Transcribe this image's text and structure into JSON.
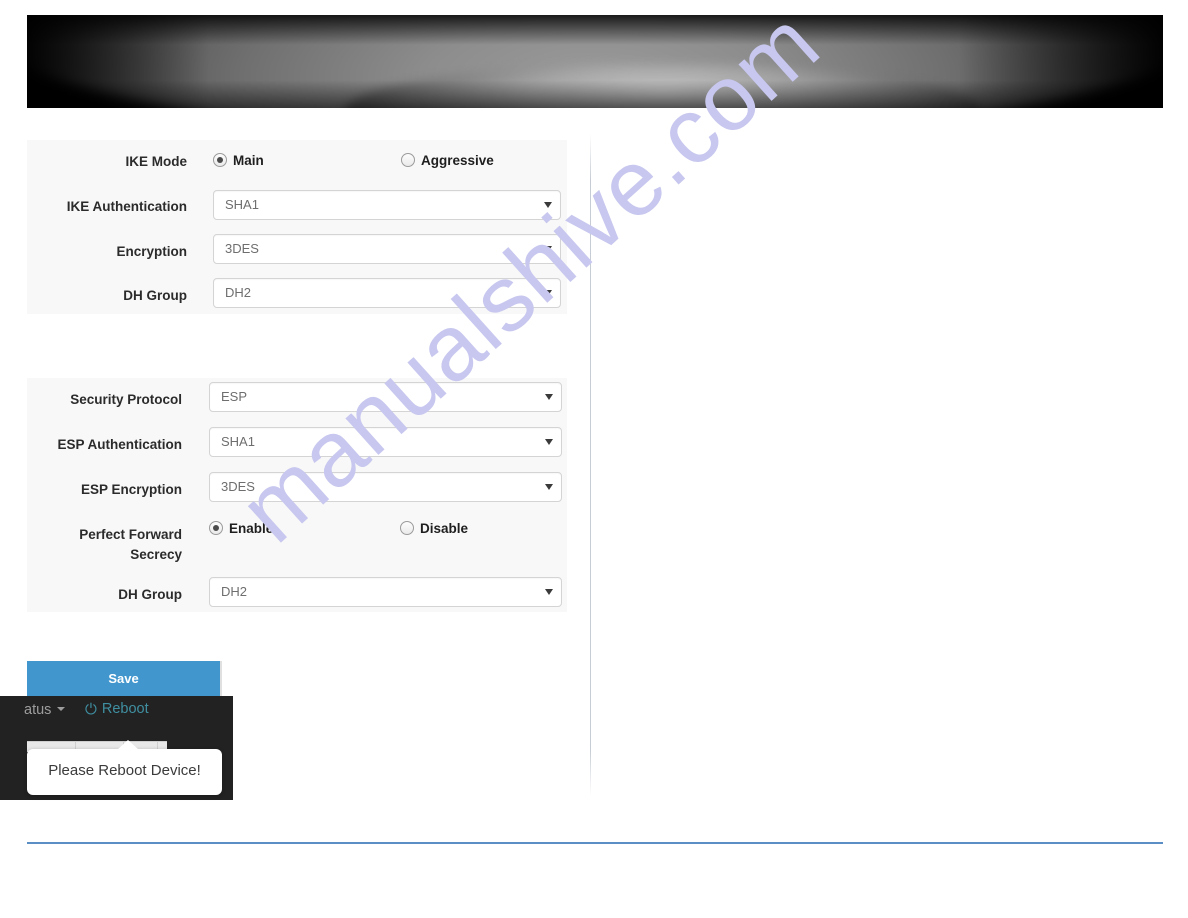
{
  "banner": {
    "name": "header-banner-image",
    "alt": "dark product photo banner"
  },
  "watermark": {
    "text": "manualshive.com"
  },
  "phase1": {
    "fields": [
      {
        "label": "IKE Mode",
        "type": "radio",
        "options": [
          {
            "label": "Main",
            "selected": true
          },
          {
            "label": "Aggressive",
            "selected": false
          }
        ]
      },
      {
        "label": "IKE Authentication",
        "type": "select",
        "value": "SHA1"
      },
      {
        "label": "Encryption",
        "type": "select",
        "value": "3DES"
      },
      {
        "label": "DH Group",
        "type": "select",
        "value": "DH2"
      }
    ]
  },
  "phase2": {
    "fields": [
      {
        "label": "Security Protocol",
        "type": "select",
        "value": "ESP"
      },
      {
        "label": "ESP Authentication",
        "type": "select",
        "value": "SHA1"
      },
      {
        "label": "ESP Encryption",
        "type": "select",
        "value": "3DES"
      },
      {
        "label": "Perfect Forward Secrecy",
        "label_line1": "Perfect Forward",
        "label_line2": "Secrecy",
        "type": "radio",
        "options": [
          {
            "label": "Enable",
            "selected": true
          },
          {
            "label": "Disable",
            "selected": false
          }
        ]
      },
      {
        "label": "DH Group",
        "type": "select",
        "value": "DH2"
      }
    ]
  },
  "actions": {
    "save_label": "Save"
  },
  "navbar": {
    "status_label": "atus",
    "reboot_label": "Reboot",
    "power_glyph": "⏻"
  },
  "tooltip": {
    "message": "Please Reboot Device!"
  },
  "colors": {
    "save_button": "#4096cd",
    "navbar_background": "#222222",
    "reboot_link": "#3f8fa1",
    "bottom_rule": "#5b8ec4",
    "panel_background": "#f8f8f8",
    "watermark": "#c7c7ef"
  }
}
